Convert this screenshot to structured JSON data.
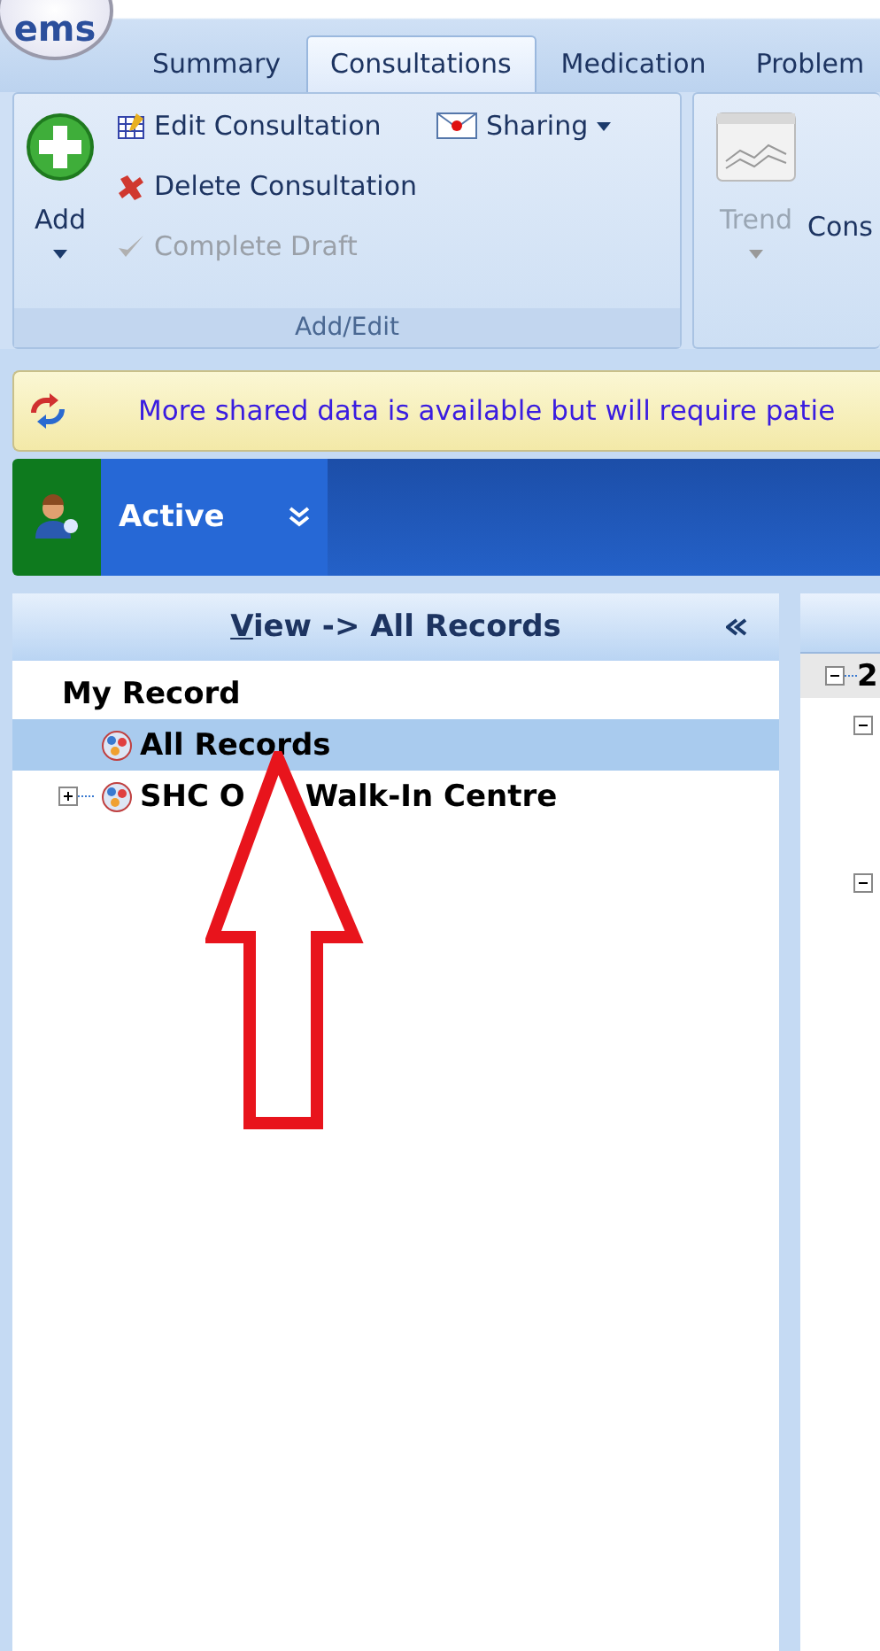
{
  "app_logo": "ems",
  "tabs": [
    {
      "label": "Summary",
      "selected": false
    },
    {
      "label": "Consultations",
      "selected": true
    },
    {
      "label": "Medication",
      "selected": false
    },
    {
      "label": "Problem",
      "selected": false
    }
  ],
  "ribbon": {
    "add_edit": {
      "label": "Add/Edit",
      "add_button": "Add",
      "items": [
        {
          "label": "Edit Consultation",
          "kind": "edit",
          "disabled": false
        },
        {
          "label": "Delete Consultation",
          "kind": "delete",
          "disabled": false
        },
        {
          "label": "Complete Draft",
          "kind": "complete",
          "disabled": true
        }
      ],
      "sharing": "Sharing"
    },
    "other": [
      {
        "label": "Trend",
        "kind": "trend",
        "disabled": true
      },
      {
        "label": "Cons",
        "kind": "text",
        "disabled": false
      }
    ]
  },
  "notification": "More shared data is available but will require patie",
  "patient_bar": {
    "status": "Active"
  },
  "left_panel": {
    "title": "View -> All Records",
    "tree": [
      {
        "label": "My Record",
        "kind": "heading",
        "selected": false
      },
      {
        "label": "All Records",
        "kind": "record",
        "selected": true
      },
      {
        "label": "SHC O",
        "label_after_arrow": "Walk-In Centre",
        "kind": "record",
        "selected": false,
        "expanded": false
      }
    ]
  },
  "right_panel": {
    "tree": [
      {
        "label": "2",
        "expanded": true,
        "children": [
          {
            "expanded": true
          },
          {
            "expanded": true
          }
        ]
      }
    ]
  }
}
